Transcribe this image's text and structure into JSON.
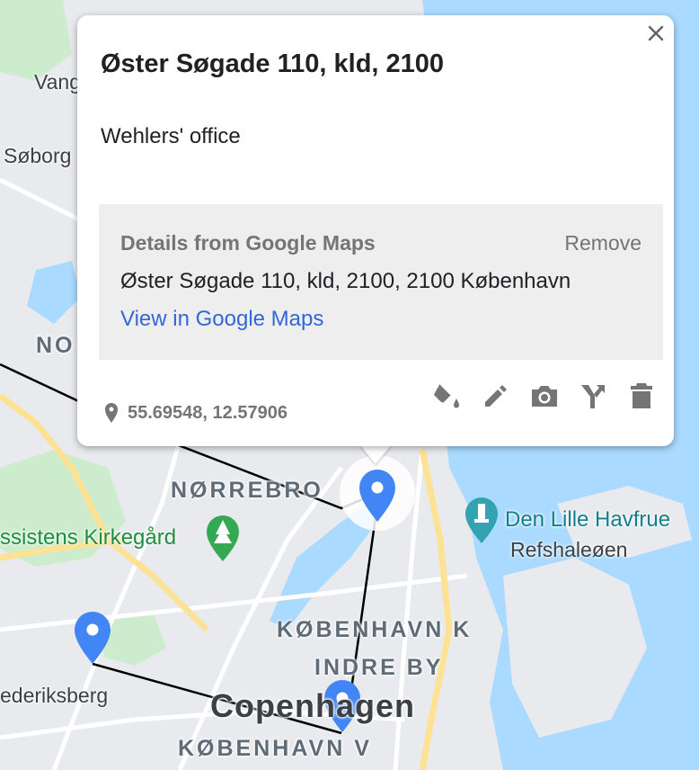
{
  "map": {
    "districts": {
      "norrebro": "NØRREBRO",
      "nordvest": "NO",
      "kobenhavn_k": "KØBENHAVN K",
      "indre_by": "INDRE BY",
      "kobenhavn_v": "KØBENHAVN V"
    },
    "places": {
      "vang": "Vang",
      "soborg": "Søborg",
      "frederiksberg": "ederiksberg",
      "refshaleoen": "Refshaleøen"
    },
    "city": "Copenhagen",
    "pois": {
      "assistens": "ssistens Kirkegård",
      "havfrue": "Den Lille Havfrue"
    },
    "colors": {
      "water": "#aadaff",
      "land": "#e8eaed",
      "park": "#cdeccd",
      "road": "#ffffff",
      "arterial": "#fde293",
      "marker": "#4285f4"
    }
  },
  "info_window": {
    "close_icon": "close-icon",
    "title": "Øster Søgade 110, kld, 2100",
    "description": "Wehlers' office",
    "details": {
      "heading": "Details from Google Maps",
      "remove_label": "Remove",
      "address": "Øster Søgade 110, kld, 2100, 2100 København",
      "link_label": "View in Google Maps"
    },
    "coordinates": "55.69548, 12.57906",
    "toolbar_icons": [
      "paint-bucket-icon",
      "pencil-icon",
      "camera-icon",
      "directions-icon",
      "trash-icon"
    ]
  }
}
